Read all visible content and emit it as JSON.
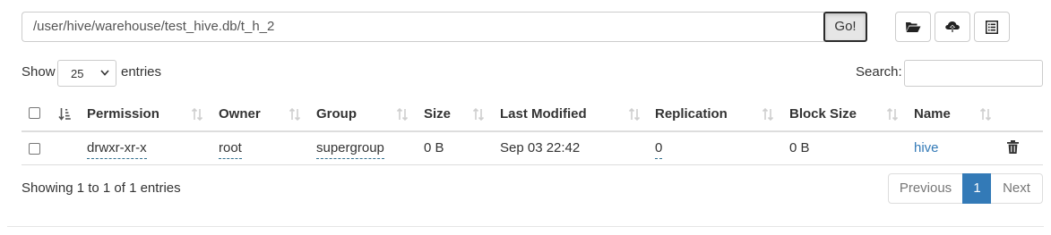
{
  "path_bar": {
    "path_value": "/user/hive/warehouse/test_hive.db/t_h_2",
    "go_label": "Go!"
  },
  "toolbar": {
    "buttons": [
      "folder-open-icon",
      "cloud-upload-icon",
      "list-icon"
    ]
  },
  "length_menu": {
    "show_label": "Show",
    "selected": "25",
    "entries_label": "entries"
  },
  "search": {
    "label": "Search:",
    "value": ""
  },
  "table": {
    "columns": [
      "Permission",
      "Owner",
      "Group",
      "Size",
      "Last Modified",
      "Replication",
      "Block Size",
      "Name"
    ],
    "rows": [
      {
        "permission": "drwxr-xr-x",
        "owner": "root",
        "group": "supergroup",
        "size": "0 B",
        "last_modified": "Sep 03 22:42",
        "replication": "0",
        "block_size": "0 B",
        "name": "hive"
      }
    ]
  },
  "info": "Showing 1 to 1 of 1 entries",
  "pagination": {
    "previous": "Previous",
    "current": "1",
    "next": "Next"
  },
  "colors": {
    "link": "#337ab7",
    "active_page": "#337ab7"
  }
}
